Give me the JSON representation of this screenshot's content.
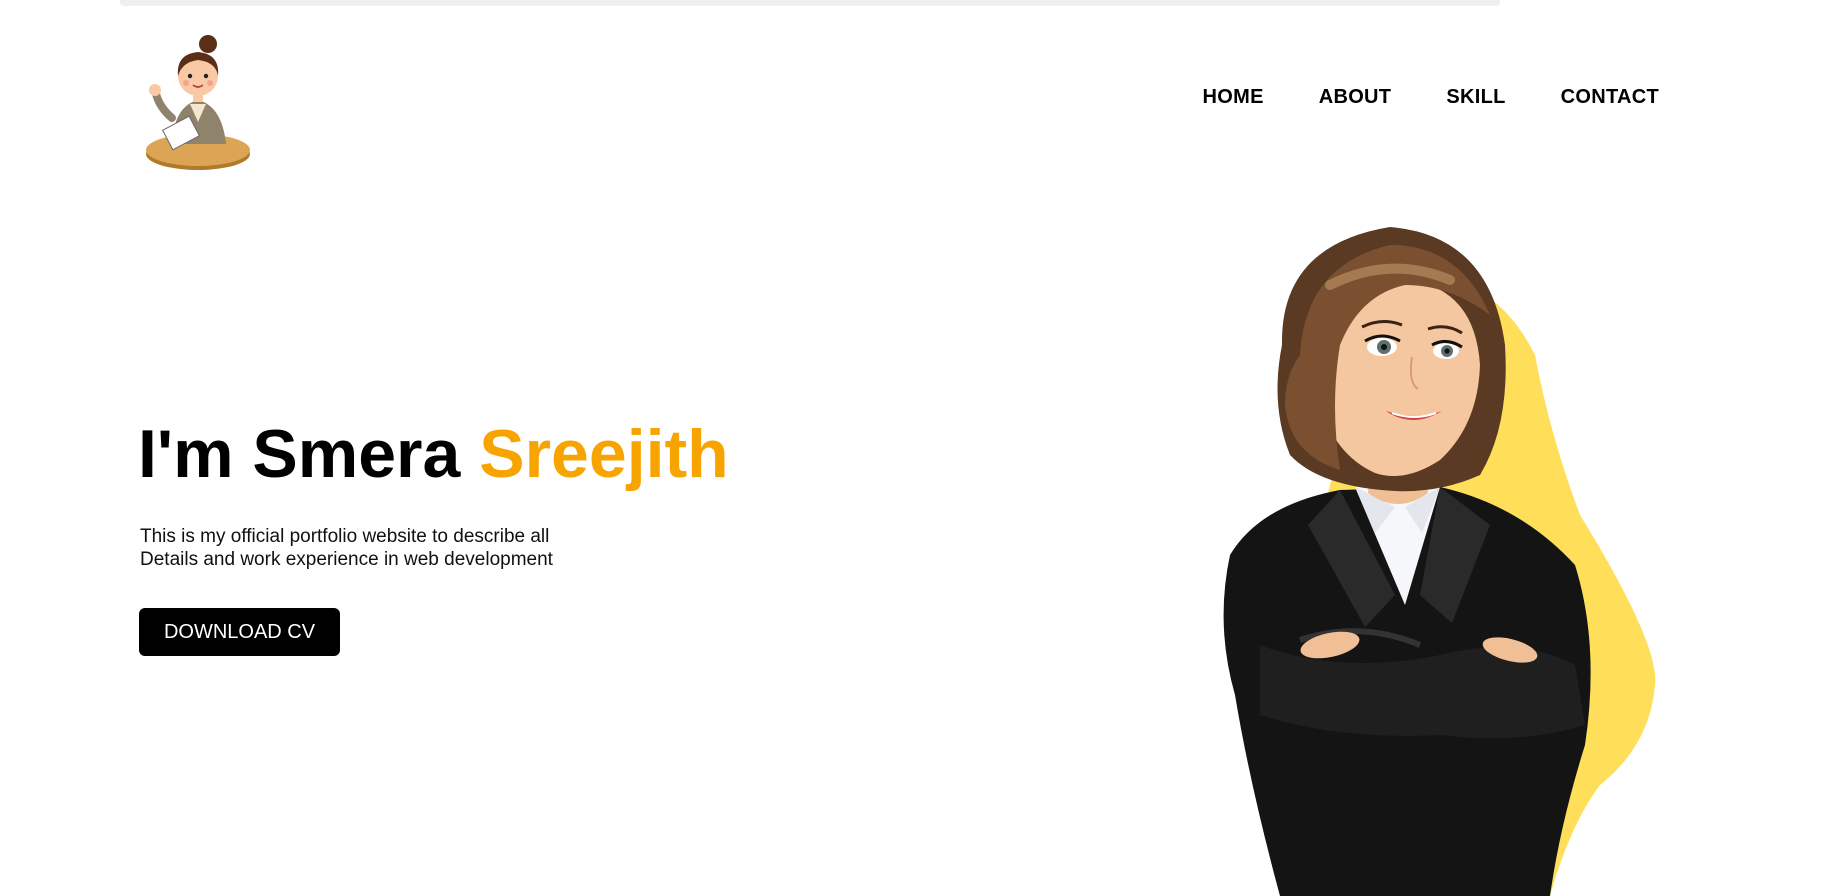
{
  "nav": {
    "items": [
      {
        "label": "HOME"
      },
      {
        "label": "ABOUT"
      },
      {
        "label": "SKILL"
      },
      {
        "label": "CONTACT"
      }
    ]
  },
  "hero": {
    "title_prefix": "I'm Smera ",
    "title_accent": "Sreejith",
    "description_line1": "This is my official portfolio website to describe all",
    "description_line2": "Details and work experience in web development",
    "cta_label": "DOWNLOAD CV"
  },
  "colors": {
    "accent": "#f7a400",
    "blob": "#ffde59",
    "button_bg": "#000000",
    "button_text": "#ffffff"
  },
  "icons": {
    "logo": "cartoon-girl-at-desk-logo",
    "hero": "businesswoman-illustration"
  }
}
